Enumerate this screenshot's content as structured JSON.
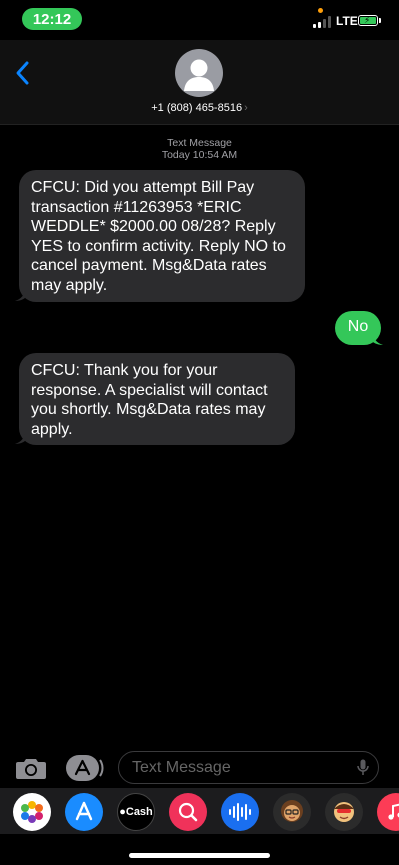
{
  "status_bar": {
    "time": "12:12",
    "network": "LTE"
  },
  "header": {
    "contact": "+1 (808) 465-8516",
    "chevron": "›"
  },
  "thread": {
    "service": "Text Message",
    "timestamp": "Today 10:54 AM",
    "messages": [
      {
        "direction": "received",
        "text": "CFCU: Did you attempt Bill Pay transaction #11263953 *ERIC WEDDLE* $2000.00 08/28? Reply YES to confirm activity. Reply NO to cancel payment. Msg&Data rates may apply."
      },
      {
        "direction": "sent",
        "text": "No"
      },
      {
        "direction": "received",
        "text": "CFCU: Thank you for your response. A specialist will contact you shortly. Msg&Data rates may apply."
      }
    ]
  },
  "input_bar": {
    "placeholder": "Text Message"
  },
  "app_strip": {
    "cash_label": "Cash",
    "apps": [
      "photos-icon",
      "app-store-icon",
      "apple-cash-icon",
      "image-search-icon",
      "audio-message-icon",
      "memoji-icon",
      "animoji-icon",
      "music-icon"
    ]
  },
  "colors": {
    "sent_bubble": "#34c759",
    "received_bubble": "#2c2c2e",
    "accent": "#0a84ff"
  }
}
